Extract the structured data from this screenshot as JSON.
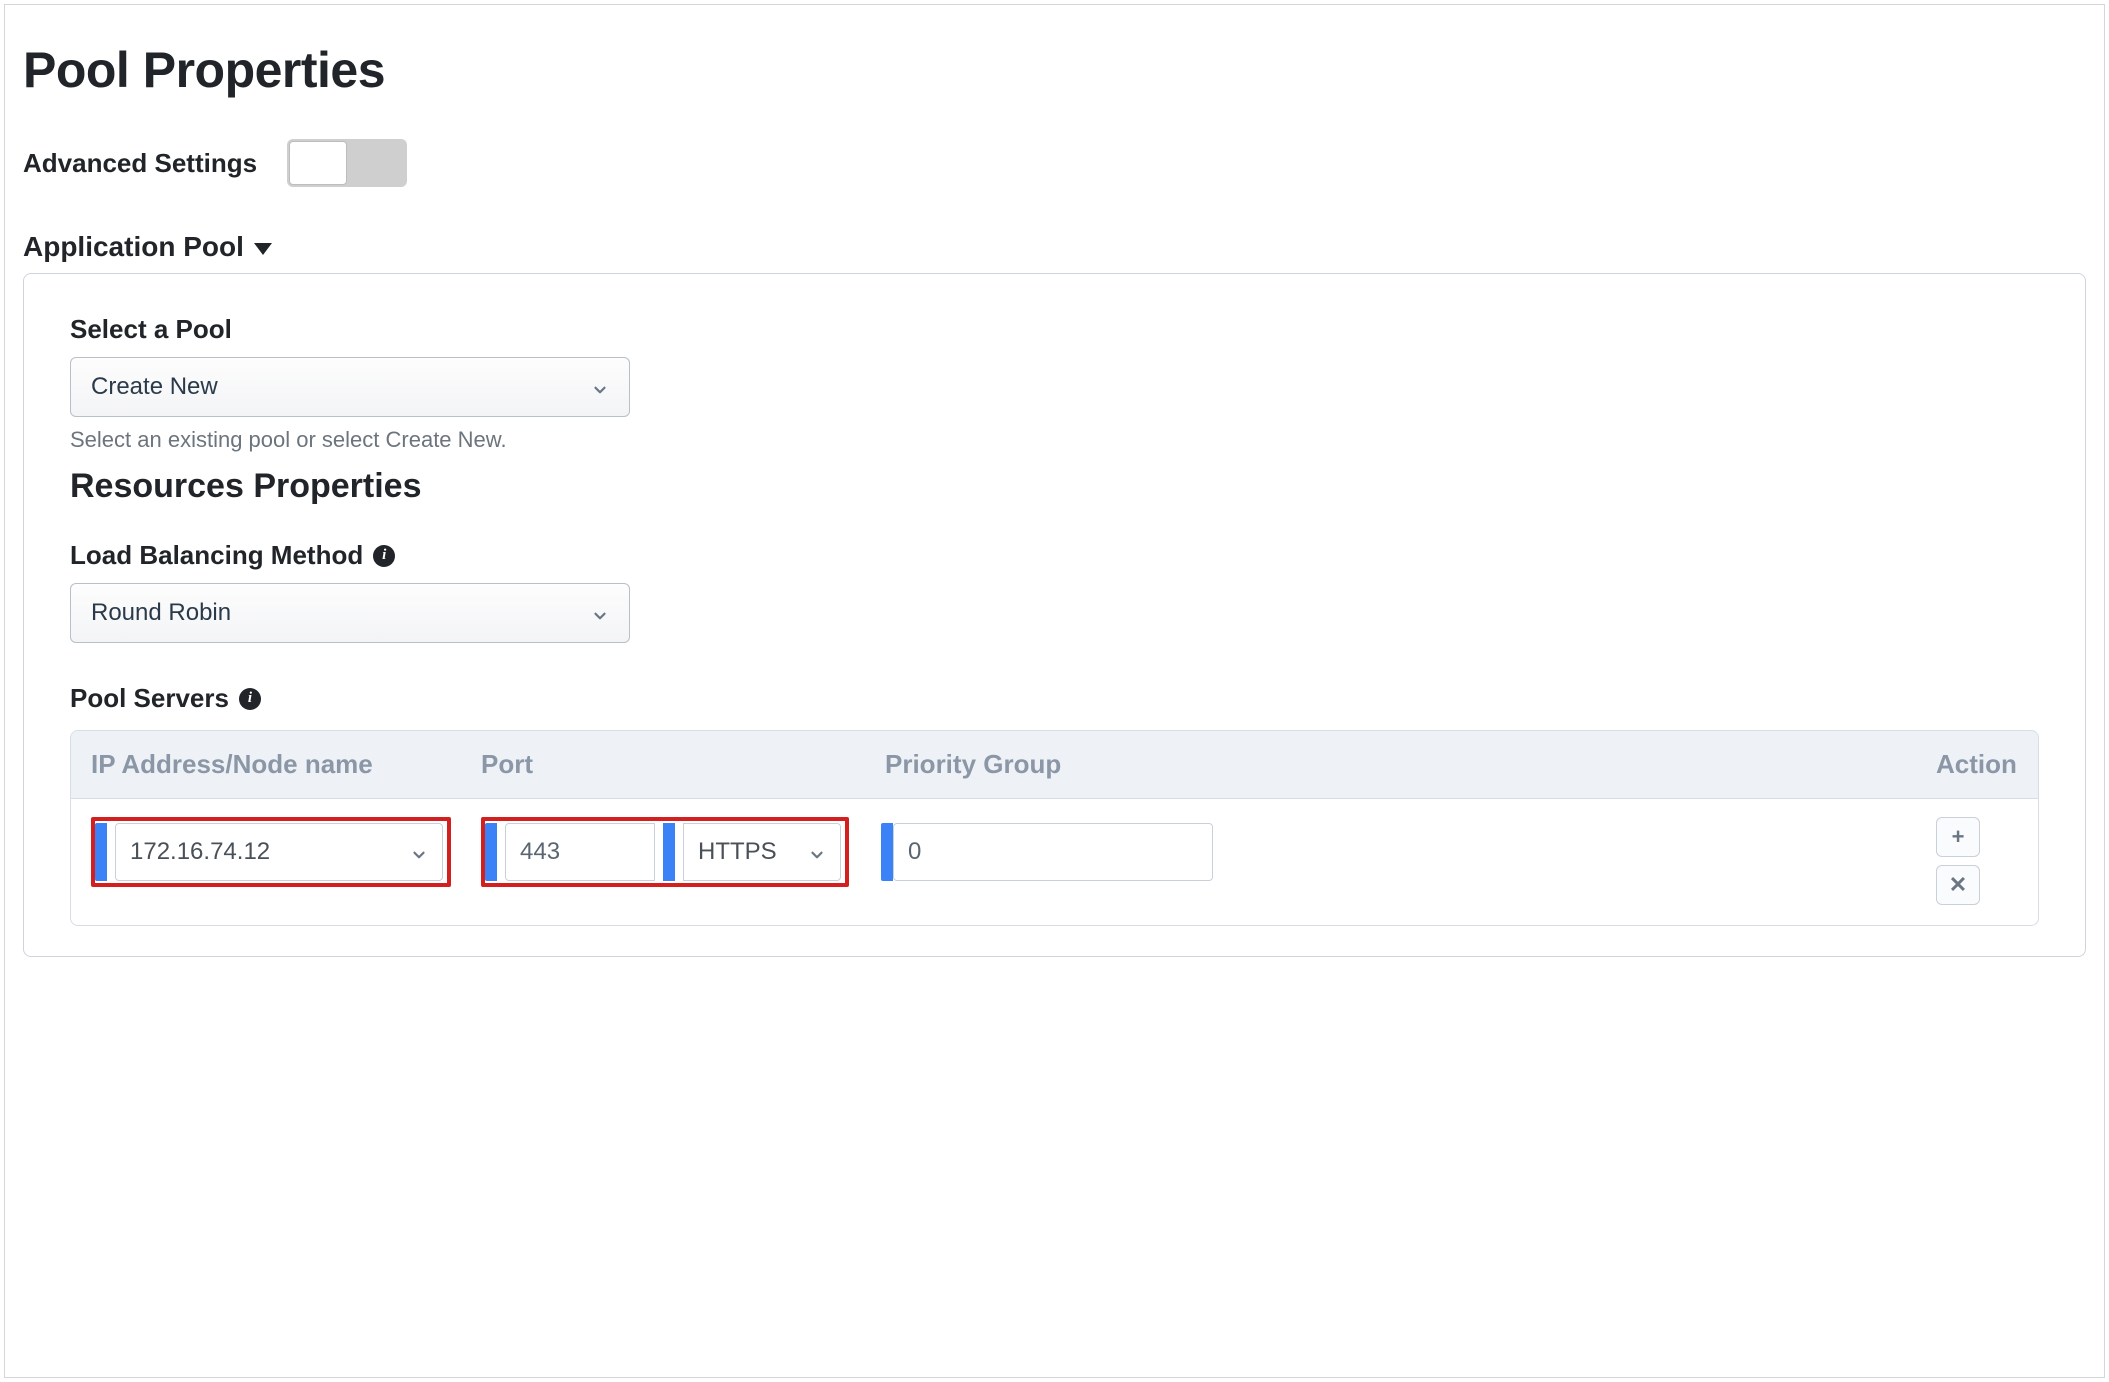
{
  "title": "Pool Properties",
  "advanced_label": "Advanced Settings",
  "section_header": "Application Pool",
  "select_pool": {
    "label": "Select a Pool",
    "value": "Create New",
    "hint": "Select an existing pool or select Create New."
  },
  "resources_heading": "Resources Properties",
  "lb_method": {
    "label": "Load Balancing Method",
    "value": "Round Robin"
  },
  "pool_servers_label": "Pool Servers",
  "table": {
    "headers": {
      "ip": "IP Address/Node name",
      "port": "Port",
      "priority": "Priority Group",
      "action": "Action"
    },
    "row": {
      "ip": "172.16.74.12",
      "port_number": "443",
      "port_protocol": "HTTPS",
      "priority": "0"
    }
  },
  "icons": {
    "plus": "+",
    "times": "✕"
  }
}
